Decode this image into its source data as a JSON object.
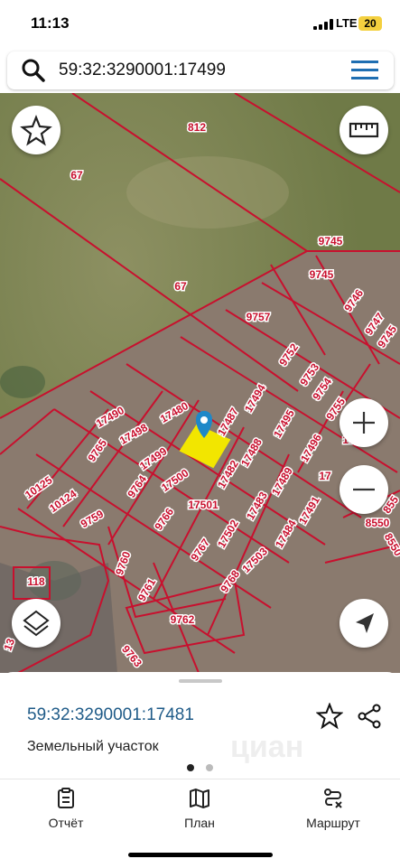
{
  "status_bar": {
    "time": "11:13",
    "network": "LTE",
    "battery": "20"
  },
  "search": {
    "query": "59:32:3290001:17499",
    "search_icon": "search-icon",
    "menu_icon": "menu-icon"
  },
  "map": {
    "colors": {
      "boundary": "#c8102e",
      "selected_fill": "#f2e600",
      "pin": "#1e88c8"
    },
    "selected_parcel": "17481",
    "parcel_labels": [
      "812",
      "67",
      "67",
      "9745",
      "9745",
      "9746",
      "9747",
      "9745",
      "9757",
      "9752",
      "9753",
      "9754",
      "9755",
      "17494",
      "17495",
      "17496",
      "17487",
      "17490",
      "17480",
      "17498",
      "9765",
      "17499",
      "17500",
      "17488",
      "17489",
      "17482",
      "17483",
      "17491",
      "17484",
      "9764",
      "17501",
      "9766",
      "17502",
      "9759",
      "10124",
      "10125",
      "9767",
      "17503",
      "9760",
      "9768",
      "118",
      "9761",
      "9762",
      "9763",
      "13",
      "8550",
      "8550",
      "855",
      "17",
      "17"
    ],
    "buttons": [
      "favorite-icon",
      "ruler-icon",
      "zoom-in-icon",
      "zoom-out-icon",
      "layers-icon",
      "location-icon"
    ]
  },
  "sheet": {
    "parcel_id": "59:32:3290001:17481",
    "type": "Земельный участок",
    "watermark": "циан"
  },
  "nav": {
    "report": "Отчёт",
    "plan": "План",
    "route": "Маршрут"
  }
}
